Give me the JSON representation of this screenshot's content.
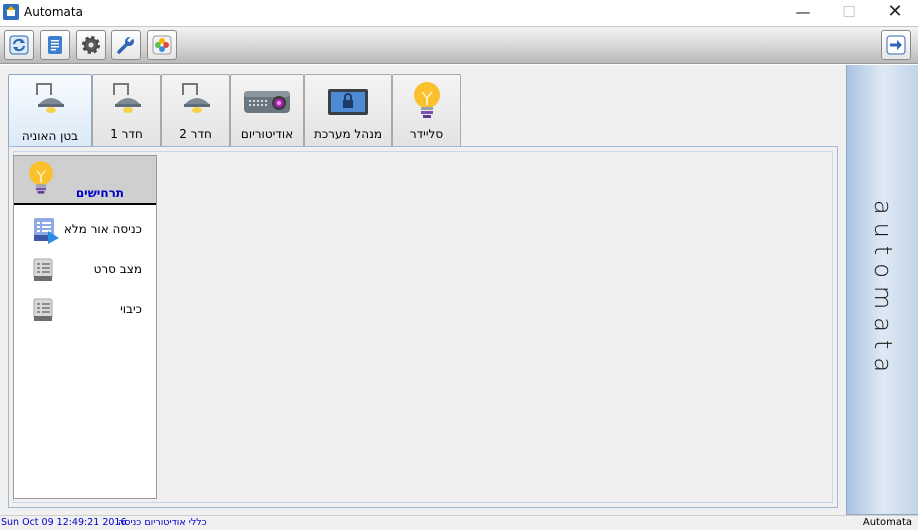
{
  "window": {
    "title": "Automata",
    "minimize": "—",
    "maximize": "☐",
    "close": "✕"
  },
  "toolbar": {
    "buttons": [
      "refresh-icon",
      "document-icon",
      "gear-icon",
      "wrench-icon",
      "photos-icon"
    ],
    "exit_icon": "arrow-right-icon"
  },
  "tabs": [
    {
      "label": "בטן האוניה",
      "icon": "ceiling-lamp-icon",
      "active": true
    },
    {
      "label": "חדר 1",
      "icon": "ceiling-lamp-icon"
    },
    {
      "label": "חדר 2",
      "icon": "ceiling-lamp-icon"
    },
    {
      "label": "אודיטוריום",
      "icon": "projector-icon"
    },
    {
      "label": "מנהל מערכת",
      "icon": "lock-screen-icon"
    },
    {
      "label": "סליידר",
      "icon": "lightbulb-icon"
    }
  ],
  "scenarios": {
    "title": "תרחישים",
    "items": [
      {
        "label": "כניסה אור מלא",
        "icon": "scenario-play-icon"
      },
      {
        "label": "מצב סרט",
        "icon": "scenario-doc-icon"
      },
      {
        "label": "כיבוי",
        "icon": "scenario-doc-icon"
      }
    ]
  },
  "side": {
    "brand": "automata"
  },
  "status": {
    "datetime": "Sun Oct 09 12:49:21 2016",
    "message": "כללי אודיטוריום כניסה",
    "app": "Automata"
  },
  "colors": {
    "accent": "#0000cc",
    "active_tab": "#dbe9f7",
    "side_panel": "#c2d5ea"
  }
}
